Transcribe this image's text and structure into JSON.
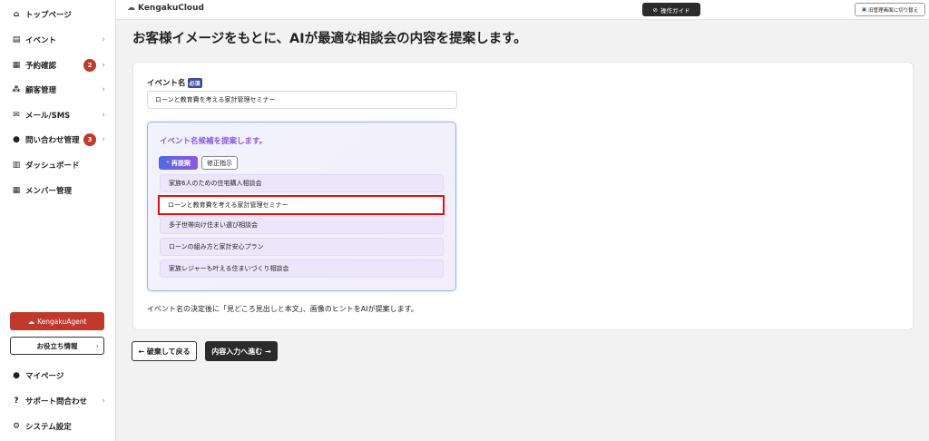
{
  "sidebar": {
    "items": [
      {
        "label": "トップページ",
        "icon": "home-icon",
        "glyph": "⌂"
      },
      {
        "label": "イベント",
        "icon": "document-icon",
        "glyph": "▤"
      },
      {
        "label": "予約確認",
        "icon": "calendar-icon",
        "glyph": "▦",
        "badge": "2"
      },
      {
        "label": "顧客管理",
        "icon": "people-icon",
        "glyph": "⁂"
      },
      {
        "label": "メール/SMS",
        "icon": "mail-icon",
        "glyph": "✉"
      },
      {
        "label": "問い合わせ管理",
        "icon": "chat-icon",
        "glyph": "●",
        "badge": "3"
      },
      {
        "label": "ダッシュボード",
        "icon": "chart-icon",
        "glyph": "▥"
      },
      {
        "label": "メンバー管理",
        "icon": "grid-icon",
        "glyph": "▦"
      }
    ],
    "agent_button": {
      "label": "KengakuAgent",
      "icon": "cloud-icon",
      "glyph": "☁"
    },
    "info_button": {
      "label": "お役立ち情報"
    },
    "bottom_items": [
      {
        "label": "マイページ",
        "icon": "user-icon",
        "glyph": "●"
      },
      {
        "label": "サポート問合わせ",
        "icon": "help-icon",
        "glyph": "?"
      },
      {
        "label": "システム設定",
        "icon": "gear-icon",
        "glyph": "⚙"
      }
    ],
    "chevron": "›"
  },
  "header": {
    "logo": "KengakuCloud",
    "logo_glyph": "☁",
    "guide_label": "操作ガイド",
    "guide_glyph": "⊘",
    "switch_label": "旧管理画面に切り替え",
    "switch_glyph": "▣"
  },
  "main": {
    "title": "お客様イメージをもとに、AIが最適な相談会の内容を提案します。",
    "event_name_label": "イベント名",
    "required_badge": "必須",
    "event_name_value": "ローンと教育費を考える家計管理セミナー",
    "suggest": {
      "title": "イベント名候補を提案します。",
      "regen_label": "再提案",
      "regen_glyph": "⁺",
      "fix_label": "修正指示",
      "candidates": [
        "家族6人のための住宅購入相談会",
        "ローンと教育費を考える家計管理セミナー",
        "多子世帯向け住まい選び相談会",
        "ローンの組み方と家計安心プラン",
        "家族レジャーも叶える住まいづくり相談会"
      ],
      "selected_index": 1
    },
    "hint": "イベント名の決定後に「見どころ見出しと本文」、画像のヒントをAIが提案します。",
    "back_label": "← 破棄して戻る",
    "next_label": "内容入力へ進む →"
  }
}
